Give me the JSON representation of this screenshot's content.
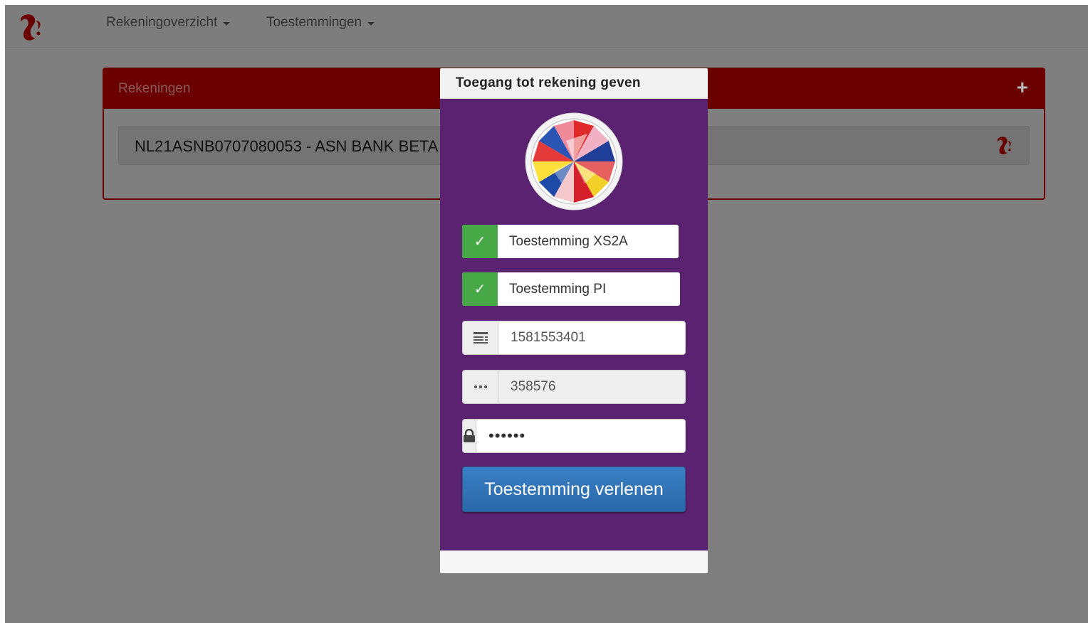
{
  "navbar": {
    "logo_icon": "squirrel-logo-icon",
    "menu": [
      {
        "label": "Rekeningoverzicht"
      },
      {
        "label": "Toestemmingen"
      }
    ]
  },
  "accounts_panel": {
    "title": "Rekeningen",
    "add_icon": "plus-icon",
    "accounts": [
      {
        "label": "NL21ASNB0707080053 - ASN BANK BETA"
      }
    ]
  },
  "consent_modal": {
    "title": "Toegang tot rekening geven",
    "bank_logo_icon": "asn-bank-logo-icon",
    "permissions": [
      {
        "label": "Toestemming XS2A",
        "checked": true
      },
      {
        "label": "Toestemming PI",
        "checked": true
      }
    ],
    "fields": {
      "account_number": {
        "value": "1581553401",
        "icon": "account-list-icon"
      },
      "pin": {
        "value": "358576",
        "icon": "dots-icon"
      },
      "password": {
        "value": "••••••",
        "icon": "lock-icon"
      }
    },
    "submit_label": "Toestemming verlenen"
  },
  "colors": {
    "overlay_gray": "#7f7f7f",
    "panel_header": "#6b0000",
    "modal_purple": "#5a2270",
    "check_green": "#46a946",
    "button_blue": "#2f72b6"
  }
}
